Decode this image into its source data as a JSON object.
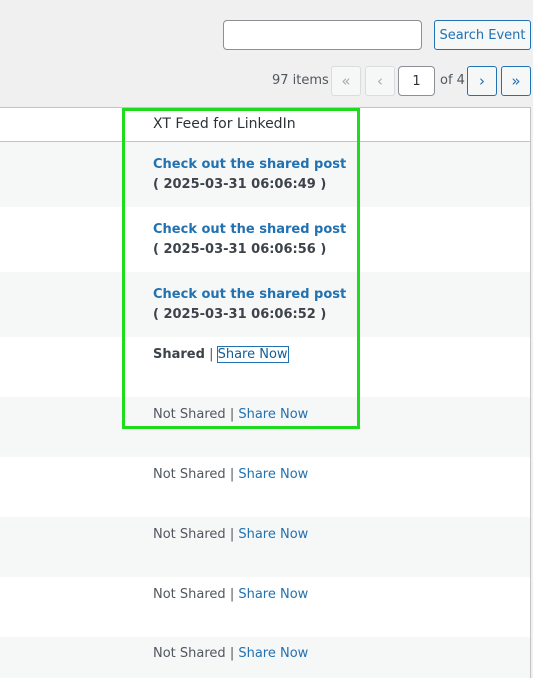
{
  "search": {
    "value": "",
    "button_label": "Search Event"
  },
  "pagination": {
    "items_label": "97 items",
    "first": "«",
    "prev": "‹",
    "current_page": "1",
    "of_label": "of 4",
    "next": "›",
    "last": "»"
  },
  "table": {
    "column_header": "XT Feed for LinkedIn",
    "shared_rows": [
      {
        "link": "Check out the shared post",
        "date": "( 2025-03-31 06:06:49 )"
      },
      {
        "link": "Check out the shared post",
        "date": "( 2025-03-31 06:06:56 )"
      },
      {
        "link": "Check out the shared post",
        "date": "( 2025-03-31 06:06:52 )"
      }
    ],
    "status_rows": [
      {
        "status": "Shared",
        "separator": " | ",
        "action": "Share Now"
      },
      {
        "status": "Not Shared",
        "separator": " | ",
        "action": "Share Now"
      },
      {
        "status": "Not Shared",
        "separator": " | ",
        "action": "Share Now"
      },
      {
        "status": "Not Shared",
        "separator": " | ",
        "action": "Share Now"
      },
      {
        "status": "Not Shared",
        "separator": " | ",
        "action": "Share Now"
      },
      {
        "status": "Not Shared",
        "separator": " | ",
        "action": "Share Now"
      }
    ]
  },
  "colors": {
    "highlight": "#1edb1e",
    "link": "#2271b1"
  }
}
